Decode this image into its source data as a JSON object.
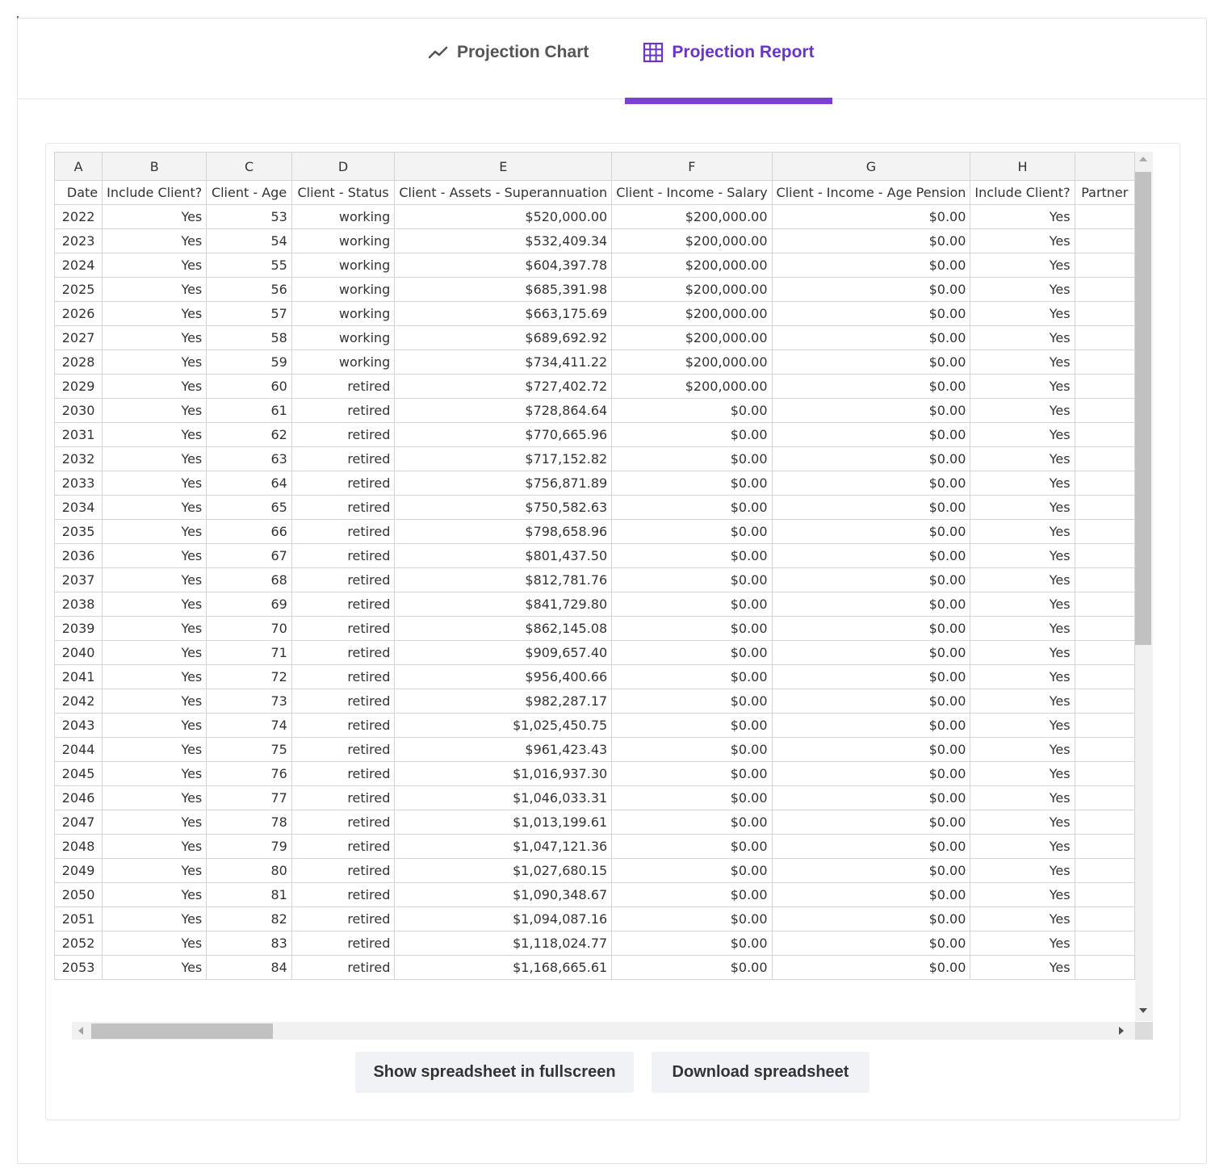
{
  "tabs": [
    {
      "label": "Projection Chart",
      "icon": "trend-line-icon",
      "active": false
    },
    {
      "label": "Projection Report",
      "icon": "table-grid-icon",
      "active": true
    }
  ],
  "colors": {
    "accent": "#7b3fd1",
    "accent_text": "#6a34c7",
    "button_bg": "#f1f2f6"
  },
  "spreadsheet": {
    "column_letters": [
      "A",
      "B",
      "C",
      "D",
      "E",
      "F",
      "G",
      "H",
      ""
    ],
    "headers": [
      "Date",
      "Include Client?",
      "Client - Age",
      "Client - Status",
      "Client - Assets - Superannuation",
      "Client - Income - Salary",
      "Client - Income - Age Pension",
      "Include Client?",
      "Partner"
    ],
    "rows": [
      [
        "2022",
        "Yes",
        "53",
        "working",
        "$520,000.00",
        "$200,000.00",
        "$0.00",
        "Yes",
        ""
      ],
      [
        "2023",
        "Yes",
        "54",
        "working",
        "$532,409.34",
        "$200,000.00",
        "$0.00",
        "Yes",
        ""
      ],
      [
        "2024",
        "Yes",
        "55",
        "working",
        "$604,397.78",
        "$200,000.00",
        "$0.00",
        "Yes",
        ""
      ],
      [
        "2025",
        "Yes",
        "56",
        "working",
        "$685,391.98",
        "$200,000.00",
        "$0.00",
        "Yes",
        ""
      ],
      [
        "2026",
        "Yes",
        "57",
        "working",
        "$663,175.69",
        "$200,000.00",
        "$0.00",
        "Yes",
        ""
      ],
      [
        "2027",
        "Yes",
        "58",
        "working",
        "$689,692.92",
        "$200,000.00",
        "$0.00",
        "Yes",
        ""
      ],
      [
        "2028",
        "Yes",
        "59",
        "working",
        "$734,411.22",
        "$200,000.00",
        "$0.00",
        "Yes",
        ""
      ],
      [
        "2029",
        "Yes",
        "60",
        "retired",
        "$727,402.72",
        "$200,000.00",
        "$0.00",
        "Yes",
        ""
      ],
      [
        "2030",
        "Yes",
        "61",
        "retired",
        "$728,864.64",
        "$0.00",
        "$0.00",
        "Yes",
        ""
      ],
      [
        "2031",
        "Yes",
        "62",
        "retired",
        "$770,665.96",
        "$0.00",
        "$0.00",
        "Yes",
        ""
      ],
      [
        "2032",
        "Yes",
        "63",
        "retired",
        "$717,152.82",
        "$0.00",
        "$0.00",
        "Yes",
        ""
      ],
      [
        "2033",
        "Yes",
        "64",
        "retired",
        "$756,871.89",
        "$0.00",
        "$0.00",
        "Yes",
        ""
      ],
      [
        "2034",
        "Yes",
        "65",
        "retired",
        "$750,582.63",
        "$0.00",
        "$0.00",
        "Yes",
        ""
      ],
      [
        "2035",
        "Yes",
        "66",
        "retired",
        "$798,658.96",
        "$0.00",
        "$0.00",
        "Yes",
        ""
      ],
      [
        "2036",
        "Yes",
        "67",
        "retired",
        "$801,437.50",
        "$0.00",
        "$0.00",
        "Yes",
        ""
      ],
      [
        "2037",
        "Yes",
        "68",
        "retired",
        "$812,781.76",
        "$0.00",
        "$0.00",
        "Yes",
        ""
      ],
      [
        "2038",
        "Yes",
        "69",
        "retired",
        "$841,729.80",
        "$0.00",
        "$0.00",
        "Yes",
        ""
      ],
      [
        "2039",
        "Yes",
        "70",
        "retired",
        "$862,145.08",
        "$0.00",
        "$0.00",
        "Yes",
        ""
      ],
      [
        "2040",
        "Yes",
        "71",
        "retired",
        "$909,657.40",
        "$0.00",
        "$0.00",
        "Yes",
        ""
      ],
      [
        "2041",
        "Yes",
        "72",
        "retired",
        "$956,400.66",
        "$0.00",
        "$0.00",
        "Yes",
        ""
      ],
      [
        "2042",
        "Yes",
        "73",
        "retired",
        "$982,287.17",
        "$0.00",
        "$0.00",
        "Yes",
        ""
      ],
      [
        "2043",
        "Yes",
        "74",
        "retired",
        "$1,025,450.75",
        "$0.00",
        "$0.00",
        "Yes",
        ""
      ],
      [
        "2044",
        "Yes",
        "75",
        "retired",
        "$961,423.43",
        "$0.00",
        "$0.00",
        "Yes",
        ""
      ],
      [
        "2045",
        "Yes",
        "76",
        "retired",
        "$1,016,937.30",
        "$0.00",
        "$0.00",
        "Yes",
        ""
      ],
      [
        "2046",
        "Yes",
        "77",
        "retired",
        "$1,046,033.31",
        "$0.00",
        "$0.00",
        "Yes",
        ""
      ],
      [
        "2047",
        "Yes",
        "78",
        "retired",
        "$1,013,199.61",
        "$0.00",
        "$0.00",
        "Yes",
        ""
      ],
      [
        "2048",
        "Yes",
        "79",
        "retired",
        "$1,047,121.36",
        "$0.00",
        "$0.00",
        "Yes",
        ""
      ],
      [
        "2049",
        "Yes",
        "80",
        "retired",
        "$1,027,680.15",
        "$0.00",
        "$0.00",
        "Yes",
        ""
      ],
      [
        "2050",
        "Yes",
        "81",
        "retired",
        "$1,090,348.67",
        "$0.00",
        "$0.00",
        "Yes",
        ""
      ],
      [
        "2051",
        "Yes",
        "82",
        "retired",
        "$1,094,087.16",
        "$0.00",
        "$0.00",
        "Yes",
        ""
      ],
      [
        "2052",
        "Yes",
        "83",
        "retired",
        "$1,118,024.77",
        "$0.00",
        "$0.00",
        "Yes",
        ""
      ],
      [
        "2053",
        "Yes",
        "84",
        "retired",
        "$1,168,665.61",
        "$0.00",
        "$0.00",
        "Yes",
        ""
      ]
    ]
  },
  "buttons": {
    "fullscreen": "Show spreadsheet in fullscreen",
    "download": "Download spreadsheet"
  }
}
